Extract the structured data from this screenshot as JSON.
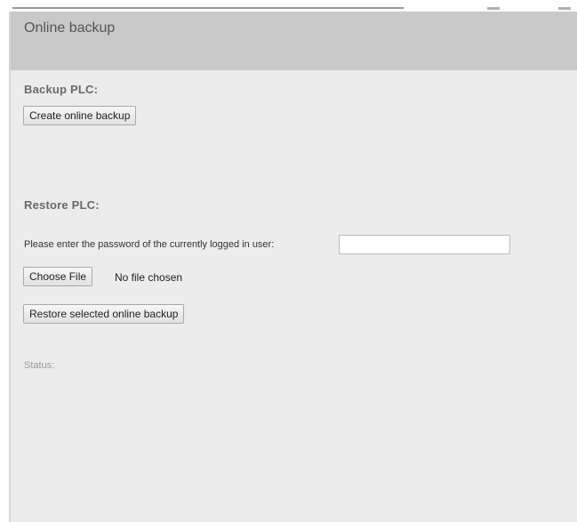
{
  "panel": {
    "title": "Online backup"
  },
  "backup": {
    "heading": "Backup PLC:",
    "create_button_label": "Create online backup"
  },
  "restore": {
    "heading": "Restore PLC:",
    "password_label": "Please enter the password of the currently logged in user:",
    "password_value": "",
    "choose_file_label": "Choose File",
    "file_status": "No file chosen",
    "restore_button_label": "Restore selected online backup"
  },
  "status": {
    "label": "Status:"
  }
}
